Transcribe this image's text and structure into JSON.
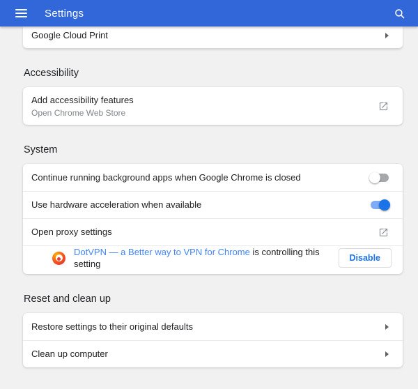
{
  "header": {
    "title": "Settings",
    "menu_icon": "hamburger",
    "search_icon": "magnifier"
  },
  "cloud_print_card": {
    "rows": [
      {
        "label": "Google Cloud Print",
        "trailing_icon": "chevron-right"
      }
    ]
  },
  "accessibility_section": {
    "heading": "Accessibility",
    "rows": [
      {
        "title": "Add accessibility features",
        "subtitle": "Open Chrome Web Store",
        "trailing_icon": "external-link"
      }
    ]
  },
  "system_section": {
    "heading": "System",
    "background_apps_row": {
      "label": "Continue running background apps when Google Chrome is closed",
      "toggle_state": "off"
    },
    "hardware_acceleration_row": {
      "label": "Use hardware acceleration when available",
      "toggle_state": "on"
    },
    "proxy_row": {
      "label": "Open proxy settings",
      "trailing_icon": "external-link"
    },
    "extension_row": {
      "extension_icon": "dotvpn-logo",
      "extension_name": "DotVPN — a Better way to VPN for Chrome",
      "status_text": " is controlling this setting",
      "button_label": "Disable"
    }
  },
  "reset_section": {
    "heading": "Reset and clean up",
    "rows": [
      {
        "label": "Restore settings to their original defaults",
        "trailing_icon": "chevron-right"
      },
      {
        "label": "Clean up computer",
        "trailing_icon": "chevron-right"
      }
    ]
  },
  "colors": {
    "header_bg": "#3267d9",
    "page_bg": "#f1f1f1",
    "card_bg": "#ffffff",
    "primary_text": "#202124",
    "secondary_text": "#80868b",
    "link": "#4285f4",
    "accent": "#1a73e8",
    "toggle_on_track": "#7eabf5",
    "toggle_on_thumb": "#1a73e8",
    "toggle_off_track": "#a6a9ac",
    "toggle_off_thumb": "#ffffff"
  }
}
